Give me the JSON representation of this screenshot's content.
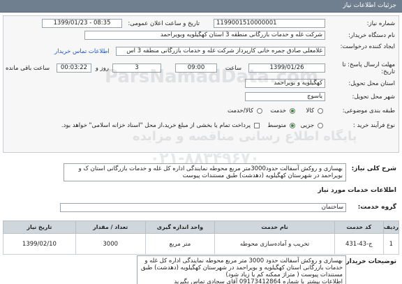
{
  "header": {
    "title": "جزئیات اطلاعات نیاز"
  },
  "form": {
    "need_number_label": "شماره نیاز:",
    "need_number": "1199001510000001",
    "announce_label": "تاریخ و ساعت اعلان عمومی:",
    "announce_value": "1399/01/23 - 08:35",
    "buyer_label": "نام دستگاه خریدار:",
    "buyer_value": "شرکت غله و خدمات بازرگانی منطقه 3 استان کهگیلویه وبویراحمد",
    "creator_label": "ایجاد کننده درخواست:",
    "creator_value": "غلامعلی صادق جمره خانی کارپرداز شرکت غله و خدمات بازرگانی منطقه 3 اس",
    "contact_link": "اطلاعات تماس خریدار",
    "deadline_label": "مهلت ارسال پاسخ: تا تاریخ:",
    "deadline_date": "1399/01/26",
    "time_label": "ساعت",
    "deadline_time": "09:00",
    "days_value": "3",
    "days_label": "روز و",
    "remaining_time": "00:03:22",
    "remaining_label": "ساعت باقی مانده",
    "province_label": "استان محل تحویل:",
    "province_value": "کهگیلویه و بویراحمد",
    "city_label": "شهر محل تحویل:",
    "city_value": "یاسوج",
    "category_label": "طبقه بندی موضوعی:",
    "category_options": [
      "کالا",
      "خدمت",
      "کالا/خدمت"
    ],
    "category_selected": "خدمت",
    "process_label": "نوع فرآیند خرید :",
    "process_options": [
      "جزیی",
      "متوسط"
    ],
    "process_selected": "متوسط",
    "payment_note": "پرداخت تمام یا بخشی از مبلغ خرید،از محل \"اسناد خزانه اسلامی\" خواهد بود."
  },
  "summary": {
    "label": "شرح کلی نیاز:",
    "text": "بهسازی و روکش آسفالت حدود3000متر مربع محوطه نمایندگی اداره کل غله و خدمات بازرگانی استان ک و بویراحمد در شهرستان کهگیلویه (دهدشت) طبق مستندات پیوست"
  },
  "services_section": {
    "title": "اطلاعات خدمات مورد نیاز",
    "group_label": "گروه خدمت:",
    "group_value": "ساختمان"
  },
  "table": {
    "headers": [
      "ردیف",
      "کد خدمت",
      "نام خدمت",
      "واحد اندازه گیری",
      "تعداد / مقدار",
      "تاریخ نیاز"
    ],
    "rows": [
      [
        "1",
        "ج-43-431",
        "تخریب و آماده‌سازی محوطه",
        "متر مربع",
        "3000",
        "1399/02/10"
      ]
    ]
  },
  "buyer_notes": {
    "label": "توضیحات خریدار:",
    "text": "بهسازی و روکش آسفالت حدود 3000 متر مربع محوطه نمایندگی اداره کل غله و خدمات بازرگانی استان کهگیلویه و بویراحمد در شهرستان کهگیلویه (دهدشت) طبق مستندات پیوست ( متراژ ممکنه کم یا زیاد شود)",
    "contact": "اطلاعات بیشتر با شماره 09173412864 آقای سجادی تماس بگیرید"
  },
  "watermark": {
    "site": "ParsNamadData.com",
    "phone": "۰۲۱-۸۸۳۴۹۶۷۰",
    "text": "پایگاه اطلاع رسانی مناقصه و مزایده"
  }
}
